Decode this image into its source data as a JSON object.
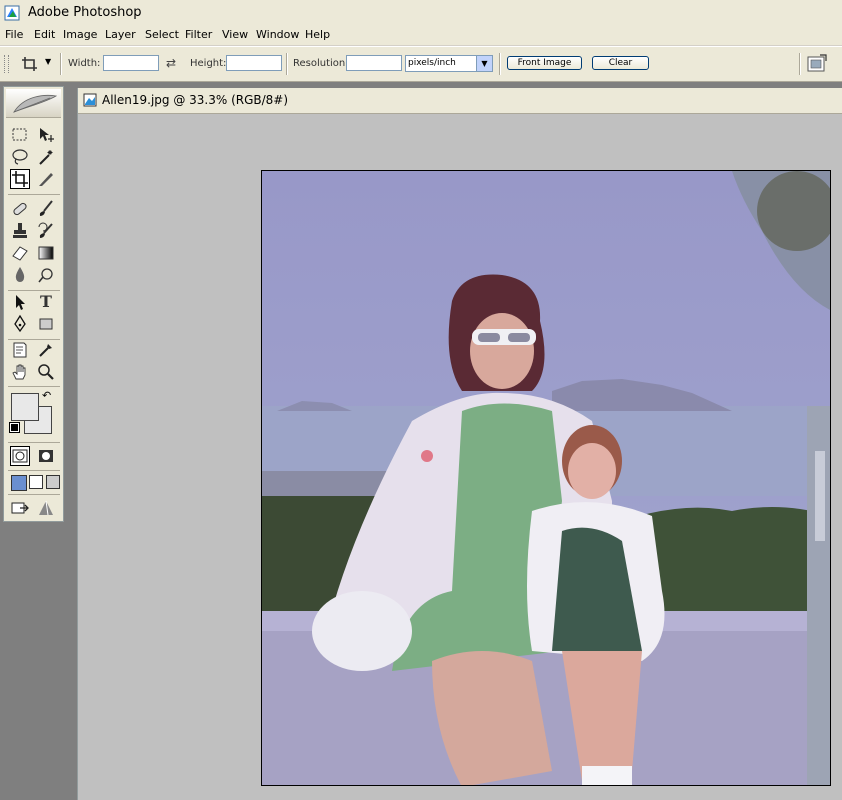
{
  "app": {
    "title": "Adobe Photoshop"
  },
  "menu": [
    "File",
    "Edit",
    "Image",
    "Layer",
    "Select",
    "Filter",
    "View",
    "Window",
    "Help"
  ],
  "options": {
    "width_label": "Width:",
    "height_label": "Height:",
    "resolution_label": "Resolution:",
    "unit_selected": "pixels/inch",
    "front_image_label": "Front Image",
    "clear_label": "Clear",
    "width_value": "",
    "height_value": "",
    "resolution_value": ""
  },
  "tools": {
    "text_glyph": "T"
  },
  "document": {
    "title": "Allen19.jpg @ 33.3% (RGB/8#)"
  },
  "colors": {
    "accent": "#0a246a",
    "chrome": "#ece9d8",
    "canvas_bg": "#c0c0c0"
  }
}
